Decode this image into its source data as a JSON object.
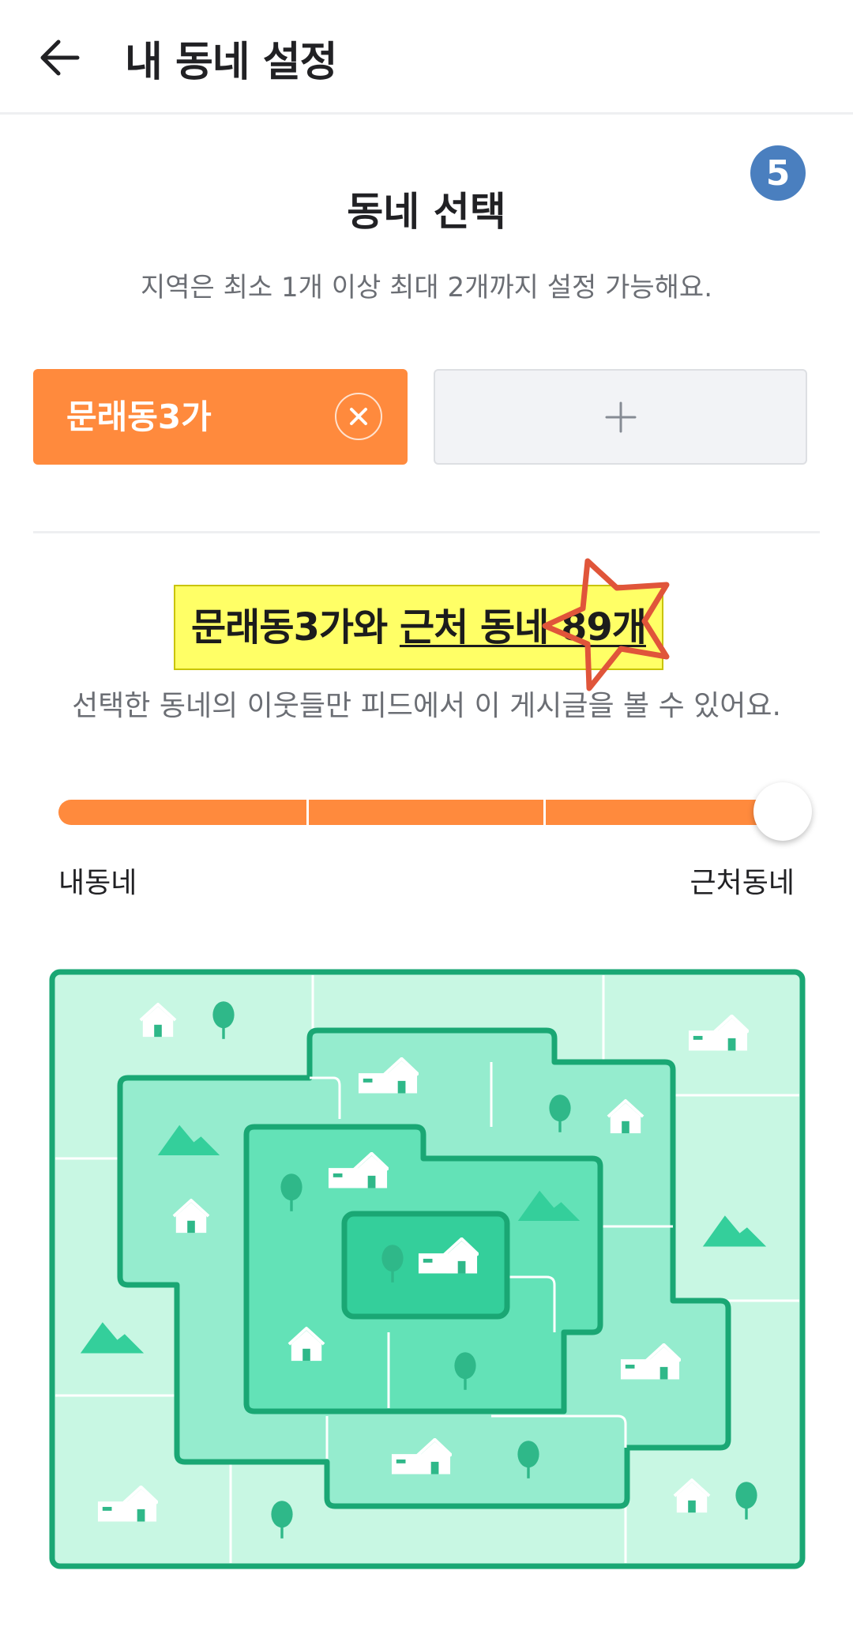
{
  "header": {
    "title": "내 동네 설정"
  },
  "step_badge": "5",
  "section": {
    "title": "동네 선택",
    "description": "지역은 최소 1개 이상 최대 2개까지 설정 가능해요."
  },
  "neighborhoods": {
    "selected_label": "문래동3가",
    "add_label": "+"
  },
  "range": {
    "headline_prefix": "문래동3가와 ",
    "headline_underlined": "근처 동네 89개",
    "note": "선택한 동네의 이웃들만 피드에서 이 게시글을 볼 수 있어요.",
    "min_label": "내동네",
    "max_label": "근처동네",
    "level": 1.0,
    "steps": 4
  },
  "colors": {
    "accent": "#ff8a3d",
    "badge": "#4a7fbf",
    "highlight": "#ffff66",
    "star": "#e0553a",
    "map_border": "#1aa774"
  },
  "icons": {
    "back": "arrow-left-icon",
    "remove": "close-icon",
    "add": "plus-icon",
    "annotation": "star-outline-icon",
    "map": "neighborhood-map-illustration"
  }
}
